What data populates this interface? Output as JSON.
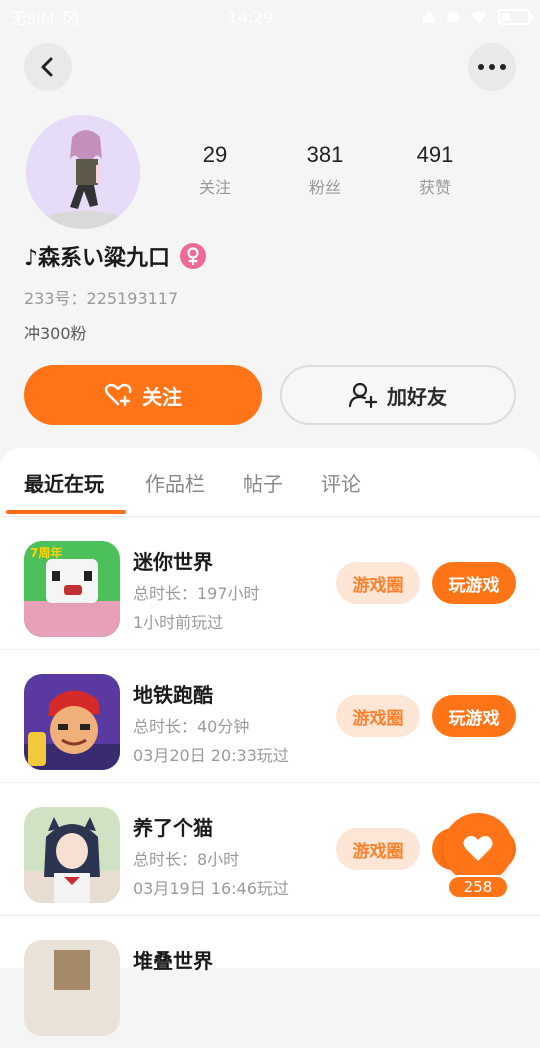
{
  "status_bar": {
    "carrier": "无SIM",
    "carrier_extra": "冈",
    "time": "14:29",
    "battery_level": 0.35
  },
  "profile": {
    "name": "♪森系い粱九口",
    "id_text": "233号：225193117",
    "bio": "冲300粉",
    "stats": [
      {
        "value": "29",
        "label": "关注"
      },
      {
        "value": "381",
        "label": "粉丝"
      },
      {
        "value": "491",
        "label": "获赞"
      }
    ]
  },
  "actions": {
    "follow_label": "关注",
    "add_friend_label": "加好友"
  },
  "tabs": [
    "最近在玩",
    "作品栏",
    "帖子",
    "评论"
  ],
  "games": [
    {
      "title": "迷你世界",
      "duration": "总时长：197小时",
      "last_played": "1小时前玩过",
      "circle_label": "游戏圈",
      "play_label": "玩游戏"
    },
    {
      "title": "地铁跑酷",
      "duration": "总时长：40分钟",
      "last_played": "03月20日 20:33玩过",
      "circle_label": "游戏圈",
      "play_label": "玩游戏"
    },
    {
      "title": "养了个猫",
      "duration": "总时长：8小时",
      "last_played": "03月19日 16:46玩过",
      "circle_label": "游戏圈",
      "play_label": "玩游戏"
    },
    {
      "title": "堆叠世界"
    }
  ],
  "floating_like": {
    "count": "258"
  },
  "icons": {
    "back": "chevron-left-icon",
    "more": "more-dots-icon",
    "gender": "female-icon",
    "follow": "heart-plus-icon",
    "add_friend": "user-plus-icon",
    "like": "heart-icon"
  },
  "colors": {
    "accent": "#ff7417",
    "accent_light": "#fde6d6",
    "gender_pink": "#ee6b98"
  }
}
